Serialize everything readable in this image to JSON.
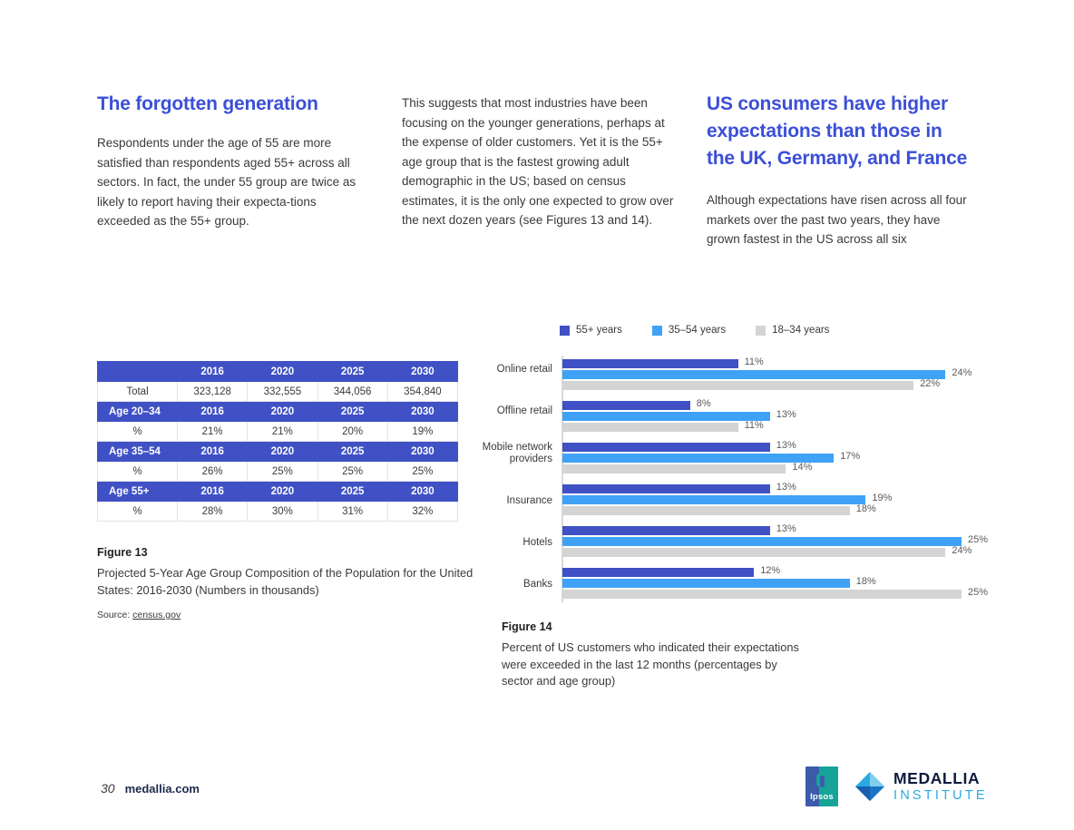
{
  "colors": {
    "heading_blue": "#3b4fd8",
    "table_header": "#3f51c5",
    "series_55plus": "#3f51c5",
    "series_35_54": "#3fa2f7",
    "series_18_34": "#d4d4d4",
    "body_text": "#3a3a3a"
  },
  "left_column": {
    "headline": "The forgotten generation",
    "paragraph": "Respondents under the age of 55 are more satisfied than respondents aged 55+ across all sectors. In fact, the under 55 group are twice as likely to report having their expecta-tions exceeded as the 55+ group."
  },
  "middle_column": {
    "paragraph": "This suggests that most industries have been focusing on the younger generations, perhaps at the expense of older customers. Yet it is the 55+ age group that is the fastest growing adult demographic in the US; based on census estimates, it is the only one expected to grow over the next dozen years (see Figures 13 and 14)."
  },
  "right_column": {
    "headline": "US consumers have higher expectations than those in the UK, Germany, and France",
    "paragraph": "Although expectations have risen across all four markets over the past two years, they have grown fastest in the US across all six"
  },
  "figure13": {
    "title": "Figure 13",
    "description": "Projected 5-Year Age Group Composition of the Population for the United States: 2016-2030 (Numbers in thousands)",
    "source_label": "Source:",
    "source_link": "census.gov",
    "table": {
      "rows": [
        {
          "type": "header",
          "cells": [
            "",
            "2016",
            "2020",
            "2025",
            "2030"
          ]
        },
        {
          "type": "data",
          "cells": [
            "Total",
            "323,128",
            "332,555",
            "344,056",
            "354,840"
          ]
        },
        {
          "type": "header",
          "cells": [
            "Age 20–34",
            "2016",
            "2020",
            "2025",
            "2030"
          ]
        },
        {
          "type": "data",
          "cells": [
            "%",
            "21%",
            "21%",
            "20%",
            "19%"
          ]
        },
        {
          "type": "header",
          "cells": [
            "Age 35–54",
            "2016",
            "2020",
            "2025",
            "2030"
          ]
        },
        {
          "type": "data",
          "cells": [
            "%",
            "26%",
            "25%",
            "25%",
            "25%"
          ]
        },
        {
          "type": "header",
          "cells": [
            "Age 55+",
            "2016",
            "2020",
            "2025",
            "2030"
          ]
        },
        {
          "type": "data",
          "cells": [
            "%",
            "28%",
            "30%",
            "31%",
            "32%"
          ]
        }
      ]
    }
  },
  "figure14": {
    "title": "Figure 14",
    "description": "Percent of US customers who indicated their expectations were exceeded in the last 12 months (percentages by sector and age group)"
  },
  "chart_data": {
    "type": "bar",
    "orientation": "horizontal",
    "title": "",
    "xlabel": "",
    "ylabel": "",
    "xlim": [
      0,
      30
    ],
    "grid": false,
    "legend_position": "top-left",
    "value_suffix": "%",
    "categories": [
      "Online retail",
      "Offline retail",
      "Mobile network providers",
      "Insurance",
      "Hotels",
      "Banks"
    ],
    "series": [
      {
        "name": "55+ years",
        "color": "#3f51c5",
        "values": [
          11,
          8,
          13,
          13,
          13,
          12
        ]
      },
      {
        "name": "35–54 years",
        "color": "#3fa2f7",
        "values": [
          24,
          13,
          17,
          19,
          25,
          18
        ]
      },
      {
        "name": "18–34 years",
        "color": "#d4d4d4",
        "values": [
          22,
          11,
          14,
          18,
          24,
          25
        ]
      }
    ]
  },
  "footer": {
    "page_number": "30",
    "site": "medallia.com",
    "ipsos_logo_text": "Ipsos",
    "medallia_name": "MEDALLIA",
    "medallia_sub": "INSTITUTE"
  }
}
